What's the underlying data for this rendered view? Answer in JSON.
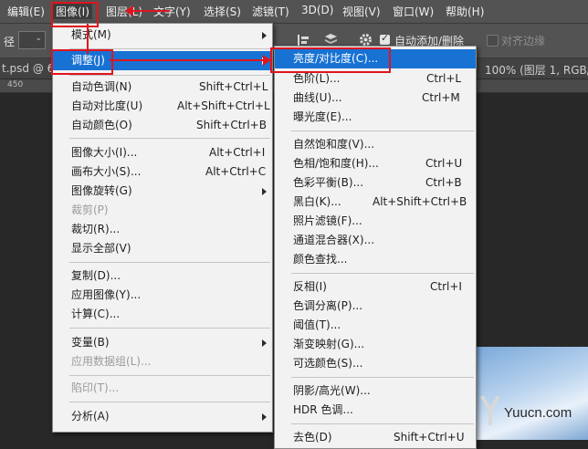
{
  "colors": {
    "menu_bg": "#f2f2f2",
    "highlight": "#1872d3",
    "annotation": "#e0141e",
    "app_bg": "#282828",
    "bar_bg": "#535353"
  },
  "menubar": [
    {
      "label": "编辑(E)"
    },
    {
      "label": "图像(I)"
    },
    {
      "label": "图层(L)"
    },
    {
      "label": "文字(Y)"
    },
    {
      "label": "选择(S)"
    },
    {
      "label": "滤镜(T)"
    },
    {
      "label": "3D(D)"
    },
    {
      "label": "视图(V)"
    },
    {
      "label": "窗口(W)"
    },
    {
      "label": "帮助(H)"
    }
  ],
  "options_bar": {
    "left_label": "径",
    "auto_add_delete": "自动添加/删除",
    "align_edges": "对齐边缘"
  },
  "tabs": {
    "left": "t.psd @ 6",
    "right": "100% (图层 1, RGB/"
  },
  "ruler": {
    "mark": "450"
  },
  "image_menu": {
    "items": [
      {
        "label": "模式(M)",
        "shortcut": "",
        "arrow": true
      },
      {
        "label": "调整(J)",
        "shortcut": "",
        "arrow": true,
        "highlight": true
      },
      {
        "label": "自动色调(N)",
        "shortcut": "Shift+Ctrl+L"
      },
      {
        "label": "自动对比度(U)",
        "shortcut": "Alt+Shift+Ctrl+L"
      },
      {
        "label": "自动颜色(O)",
        "shortcut": "Shift+Ctrl+B"
      },
      {
        "label": "图像大小(I)...",
        "shortcut": "Alt+Ctrl+I"
      },
      {
        "label": "画布大小(S)...",
        "shortcut": "Alt+Ctrl+C"
      },
      {
        "label": "图像旋转(G)",
        "shortcut": "",
        "arrow": true
      },
      {
        "label": "裁剪(P)",
        "shortcut": "",
        "disabled": true
      },
      {
        "label": "裁切(R)...",
        "shortcut": ""
      },
      {
        "label": "显示全部(V)",
        "shortcut": ""
      },
      {
        "label": "复制(D)...",
        "shortcut": ""
      },
      {
        "label": "应用图像(Y)...",
        "shortcut": ""
      },
      {
        "label": "计算(C)...",
        "shortcut": ""
      },
      {
        "label": "变量(B)",
        "shortcut": "",
        "arrow": true
      },
      {
        "label": "应用数据组(L)...",
        "shortcut": "",
        "disabled": true
      },
      {
        "label": "陷印(T)...",
        "shortcut": "",
        "disabled": true
      },
      {
        "label": "分析(A)",
        "shortcut": "",
        "arrow": true
      }
    ]
  },
  "adjust_menu": {
    "items": [
      {
        "label": "亮度/对比度(C)...",
        "shortcut": "",
        "highlight": true
      },
      {
        "label": "色阶(L)...",
        "shortcut": "Ctrl+L"
      },
      {
        "label": "曲线(U)...",
        "shortcut": "Ctrl+M"
      },
      {
        "label": "曝光度(E)...",
        "shortcut": ""
      },
      {
        "label": "自然饱和度(V)...",
        "shortcut": ""
      },
      {
        "label": "色相/饱和度(H)...",
        "shortcut": "Ctrl+U"
      },
      {
        "label": "色彩平衡(B)...",
        "shortcut": "Ctrl+B"
      },
      {
        "label": "黑白(K)...",
        "shortcut": "Alt+Shift+Ctrl+B"
      },
      {
        "label": "照片滤镜(F)...",
        "shortcut": ""
      },
      {
        "label": "通道混合器(X)...",
        "shortcut": ""
      },
      {
        "label": "颜色查找...",
        "shortcut": ""
      },
      {
        "label": "反相(I)",
        "shortcut": "Ctrl+I"
      },
      {
        "label": "色调分离(P)...",
        "shortcut": ""
      },
      {
        "label": "阈值(T)...",
        "shortcut": ""
      },
      {
        "label": "渐变映射(G)...",
        "shortcut": ""
      },
      {
        "label": "可选颜色(S)...",
        "shortcut": ""
      },
      {
        "label": "阴影/高光(W)...",
        "shortcut": ""
      },
      {
        "label": "HDR 色调...",
        "shortcut": ""
      },
      {
        "label": "去色(D)",
        "shortcut": "Shift+Ctrl+U"
      }
    ]
  },
  "watermark": {
    "text": "Yuucn.com"
  }
}
